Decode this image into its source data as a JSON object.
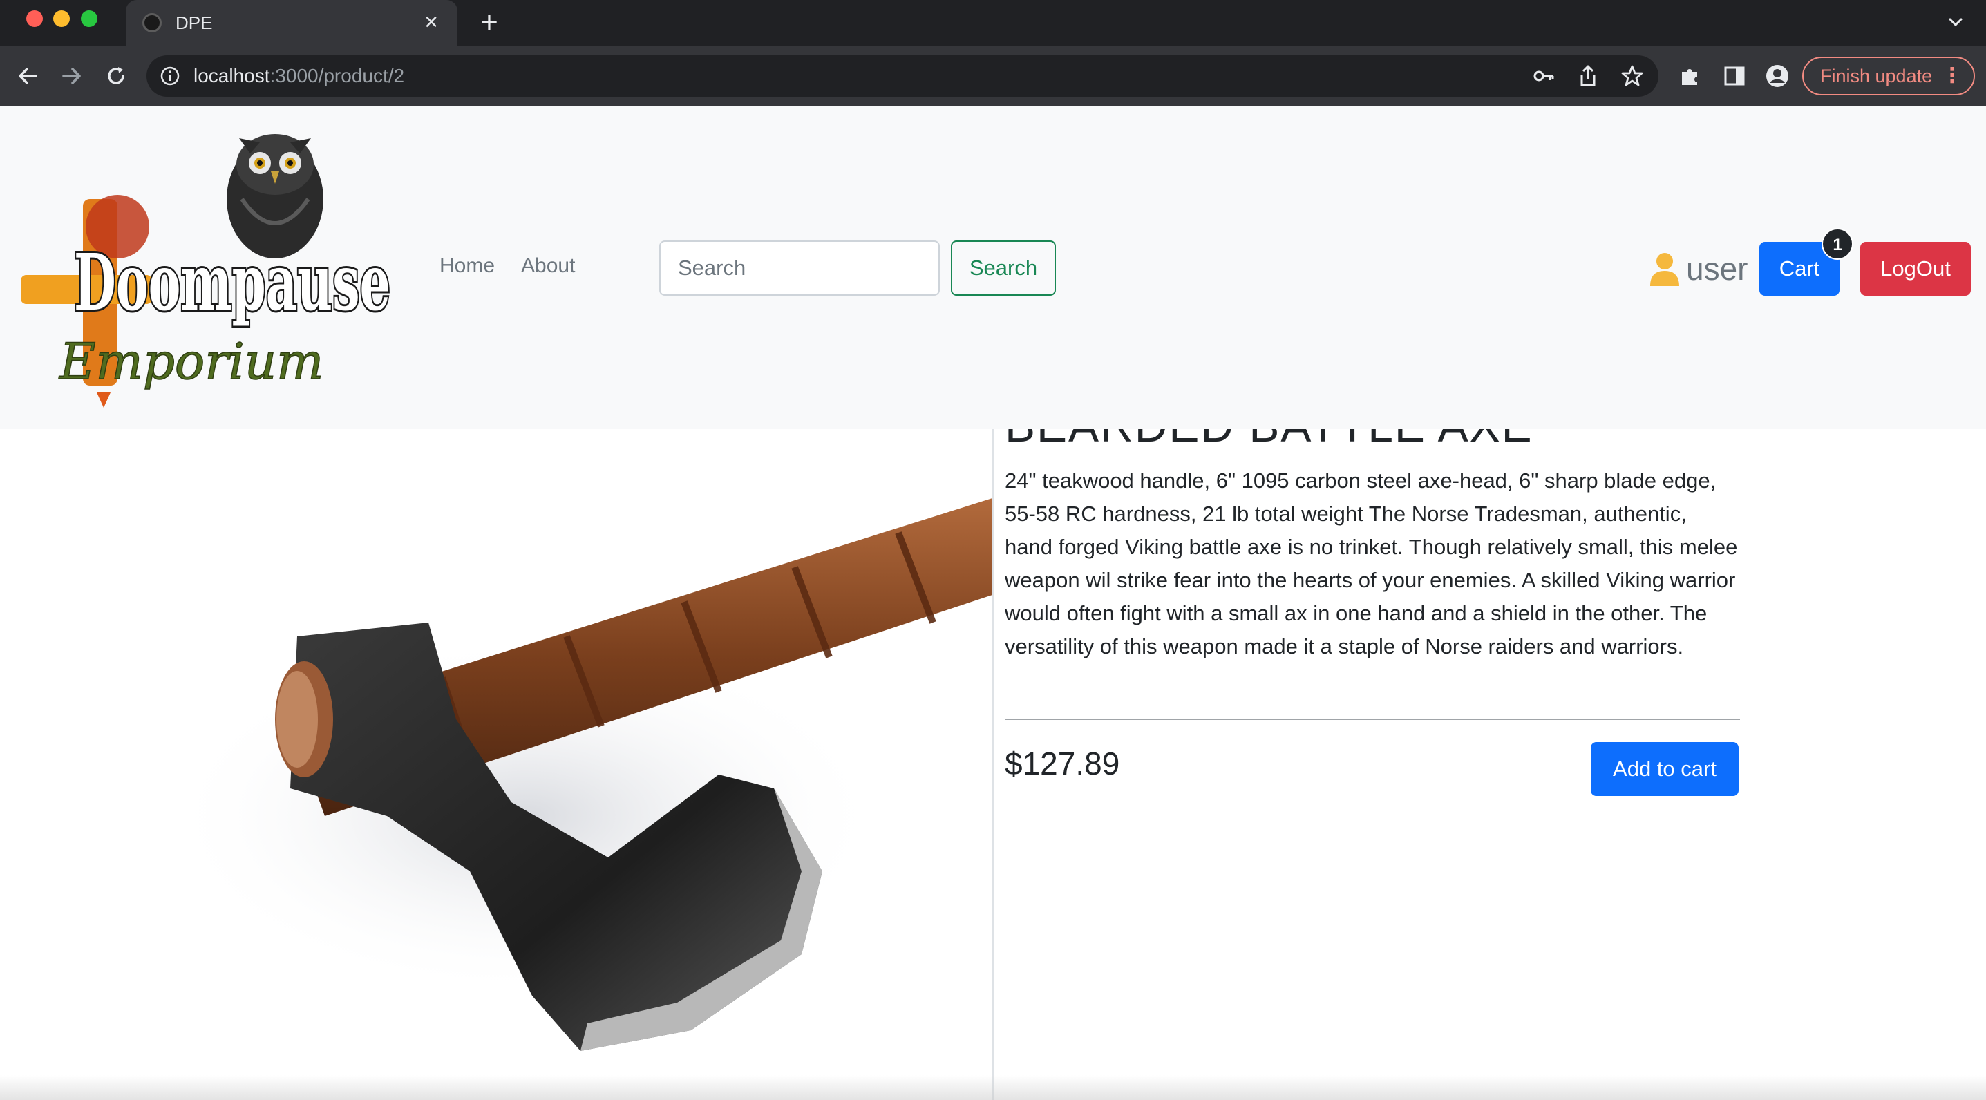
{
  "browser": {
    "tab_title": "DPE",
    "tab_close_glyph": "×",
    "new_tab_glyph": "+",
    "url_host": "localhost",
    "url_path": ":3000/product/2",
    "finish_update_label": "Finish update",
    "menu_glyph": "⋮",
    "icons": [
      "back-arrow-icon",
      "forward-arrow-icon",
      "reload-icon",
      "info-icon",
      "key-icon",
      "share-icon",
      "star-icon",
      "puzzle-icon",
      "side-panel-icon",
      "profile-icon",
      "chevron-down-icon"
    ]
  },
  "navbar": {
    "logo_text_1": "Doompause",
    "logo_text_2": "Emporium",
    "links": {
      "home": "Home",
      "about": "About"
    },
    "search": {
      "placeholder": "Search",
      "button_label": "Search"
    },
    "user_label": "user",
    "cart_label": "Cart",
    "cart_count": "1",
    "logout_label": "LogOut"
  },
  "product": {
    "title": "BEARDED BATTLE AXE",
    "description": "24\" teakwood handle, 6\" 1095 carbon steel axe-head, 6\" sharp blade edge, 55-58 RC hardness, 21 lb total weight The Norse Tradesman, authentic, hand forged Viking battle axe is no trinket. Though relatively small, this melee weapon wil strike fear into the hearts of your enemies. A skilled Viking warrior would often fight with a small ax in one hand and a shield in the other. The versatility of this weapon made it a staple of Norse raiders and warriors.",
    "price": "$127.89",
    "add_to_cart_label": "Add to cart"
  },
  "colors": {
    "primary": "#0d6efd",
    "danger": "#dc3545",
    "success": "#198754",
    "navbar_bg": "#f8f9fa",
    "user_icon": "#f5b83d"
  }
}
